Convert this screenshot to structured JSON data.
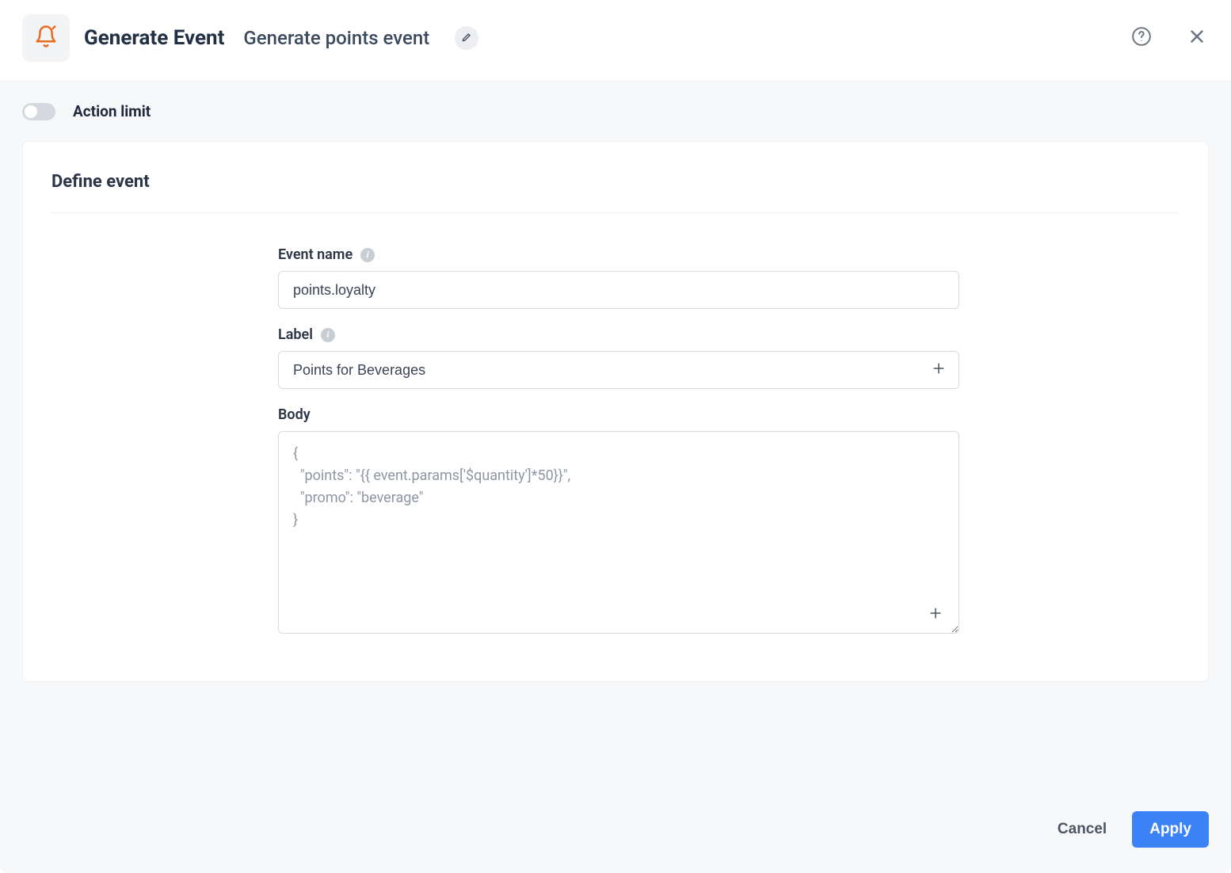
{
  "header": {
    "title": "Generate Event",
    "subtitle": "Generate points event"
  },
  "action_limit": {
    "label": "Action limit",
    "enabled": false
  },
  "section": {
    "title": "Define event"
  },
  "form": {
    "event_name": {
      "label": "Event name",
      "value": "points.loyalty"
    },
    "label_field": {
      "label": "Label",
      "value": "Points for Beverages"
    },
    "body_field": {
      "label": "Body",
      "value": "{\n  \"points\": \"{{ event.params['$quantity']*50}}\",\n  \"promo\": \"beverage\"\n}"
    }
  },
  "footer": {
    "cancel": "Cancel",
    "apply": "Apply"
  }
}
